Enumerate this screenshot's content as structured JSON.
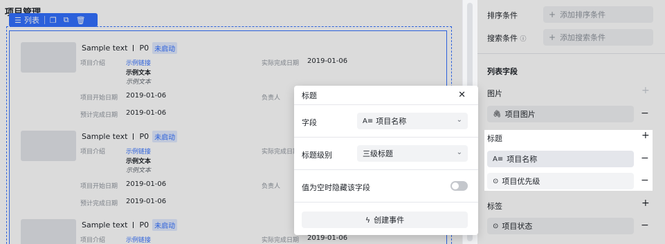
{
  "canvas": {
    "page_title": "项目管理",
    "toolbar": {
      "label": "列表"
    },
    "cards": [
      {
        "title": "Sample text",
        "priority": "P0",
        "status": "未启动",
        "intro_label": "项目介绍",
        "intro_link": "示例链接",
        "intro_bold": "示例文本",
        "intro_italic": "示例文本",
        "actual_label": "实际完成日期",
        "actual_value": "2019-01-06",
        "start_label": "项目开始日期",
        "start_value": "2019-01-06",
        "owner_label": "负责人",
        "plan_label": "预计完成日期",
        "plan_value": "2019-01-06"
      },
      {
        "title": "Sample text",
        "priority": "P0",
        "status": "未启动",
        "intro_label": "项目介绍",
        "intro_link": "示例链接",
        "intro_bold": "示例文本",
        "intro_italic": "示例文本",
        "actual_label": "实际完成日期",
        "start_label": "项目开始日期",
        "start_value": "2019-01-06",
        "owner_label": "负责人",
        "plan_label": "预计完成日期",
        "plan_value": "2019-01-06"
      },
      {
        "title": "Sample text",
        "priority": "P0",
        "status": "未启动",
        "intro_label": "项目介绍",
        "intro_link": "示例链接",
        "actual_label": "实际完成日期",
        "actual_value": "2019-01-06"
      }
    ]
  },
  "panel": {
    "sort_label": "排序条件",
    "sort_add": "添加排序条件",
    "search_label": "搜索条件",
    "search_add": "添加搜索条件",
    "list_fields_title": "列表字段",
    "image_group": "图片",
    "image_chip": "项目图片",
    "title_group": "标题",
    "title_chips": [
      "项目名称",
      "项目优先级"
    ],
    "tag_group": "标签",
    "tag_chip": "项目状态"
  },
  "modal": {
    "title": "标题",
    "field_label": "字段",
    "field_value": "项目名称",
    "level_label": "标题级别",
    "level_value": "三级标题",
    "hide_label": "值为空时隐藏该字段",
    "hide_enabled": false,
    "event_button": "创建事件"
  }
}
